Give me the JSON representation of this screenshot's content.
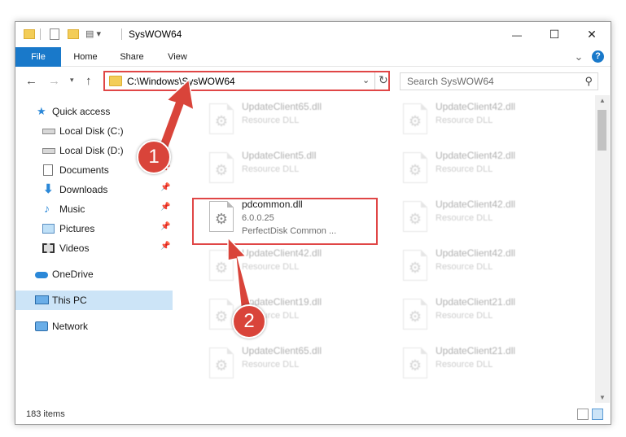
{
  "window": {
    "title": "SysWOW64",
    "controls": {
      "minimize": "—",
      "maximize": "☐",
      "close": "✕"
    }
  },
  "ribbon": {
    "tabs": [
      "File",
      "Home",
      "Share",
      "View"
    ],
    "collapse_glyph": "⌄",
    "help_glyph": "?"
  },
  "address": {
    "path": "C:\\Windows\\SysWOW64",
    "search_placeholder": "Search SysWOW64"
  },
  "nav": {
    "items": [
      {
        "label": "Quick access",
        "icon": "star-icon"
      },
      {
        "label": "Local Disk (C:)",
        "icon": "drive-icon"
      },
      {
        "label": "Local Disk (D:)",
        "icon": "drive-icon"
      },
      {
        "label": "Documents",
        "icon": "documents-icon"
      },
      {
        "label": "Downloads",
        "icon": "downloads-icon"
      },
      {
        "label": "Music",
        "icon": "music-icon"
      },
      {
        "label": "Pictures",
        "icon": "pictures-icon"
      },
      {
        "label": "Videos",
        "icon": "videos-icon"
      },
      {
        "label": "OneDrive",
        "icon": "cloud-icon"
      },
      {
        "label": "This PC",
        "icon": "computer-icon"
      },
      {
        "label": "Network",
        "icon": "network-icon"
      }
    ]
  },
  "files": [
    {
      "name": "UpdateClient65.dll",
      "type": "Resource DLL"
    },
    {
      "name": "UpdateClient42.dll",
      "type": "Resource DLL"
    },
    {
      "name": "UpdateClient5.dll",
      "type": "Resource DLL"
    },
    {
      "name": "UpdateClient42.dll",
      "type": "Resource DLL"
    },
    {
      "name": "pdcommon.dll",
      "version": "6.0.0.25",
      "description": "PerfectDisk Common ..."
    },
    {
      "name": "UpdateClient42.dll",
      "type": "Resource DLL"
    },
    {
      "name": "UpdateClient42.dll",
      "type": "Resource DLL"
    },
    {
      "name": "UpdateClient42.dll",
      "type": "Resource DLL"
    },
    {
      "name": "UpdateClient19.dll",
      "type": "Resource DLL"
    },
    {
      "name": "UpdateClient21.dll",
      "type": "Resource DLL"
    },
    {
      "name": "UpdateClient65.dll",
      "type": "Resource DLL"
    },
    {
      "name": "UpdateClient21.dll",
      "type": "Resource DLL"
    }
  ],
  "status": {
    "item_count": "183 items"
  },
  "callouts": [
    "1",
    "2"
  ],
  "colors": {
    "accent": "#1979ca",
    "highlight": "#e04646",
    "callout": "#d9443a",
    "selected_nav": "#cce4f7"
  }
}
